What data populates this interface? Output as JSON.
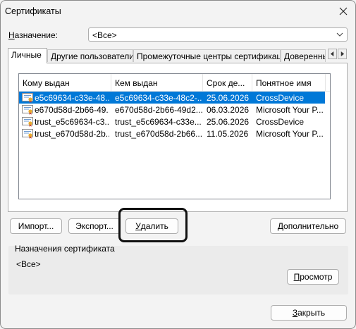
{
  "window": {
    "title": "Сертификаты",
    "close_icon": "close-icon"
  },
  "purpose": {
    "label_pre": "",
    "label_accel": "Н",
    "label_post": "азначение:",
    "value": "<Все>"
  },
  "tabs": [
    {
      "label": "Личные"
    },
    {
      "label": "Другие пользователи"
    },
    {
      "label": "Промежуточные центры сертификации"
    },
    {
      "label": "Доверенные"
    }
  ],
  "list": {
    "columns": [
      "Кому выдан",
      "Кем выдан",
      "Срок де...",
      "Понятное имя"
    ],
    "rows": [
      {
        "issued_to": "e5c69634-c33e-48...",
        "issued_by": "e5c69634-c33e-48c2-...",
        "expires": "25.06.2026",
        "friendly": "CrossDevice",
        "selected": true
      },
      {
        "issued_to": "e670d58d-2b66-49...",
        "issued_by": "e670d58d-2b66-49d2...",
        "expires": "06.03.2026",
        "friendly": "Microsoft Your P...",
        "selected": false
      },
      {
        "issued_to": "trust_e5c69634-c3...",
        "issued_by": "trust_e5c69634-c33e...",
        "expires": "25.06.2026",
        "friendly": "CrossDevice",
        "selected": false
      },
      {
        "issued_to": "trust_e670d58d-2b...",
        "issued_by": "trust_e670d58d-2b66...",
        "expires": "11.05.2026",
        "friendly": "Microsoft Your P...",
        "selected": false
      }
    ]
  },
  "buttons": {
    "import": {
      "pre": "Импорт...",
      "accel": "",
      "post": ""
    },
    "export": {
      "pre": "Экспорт...",
      "accel": "",
      "post": ""
    },
    "delete": {
      "pre": "",
      "accel": "У",
      "post": "далить"
    },
    "advanced": {
      "pre": "",
      "accel": "Д",
      "post": "ополнительно"
    },
    "view": {
      "pre": "",
      "accel": "П",
      "post": "росмотр"
    },
    "close": {
      "pre": "",
      "accel": "З",
      "post": "акрыть"
    }
  },
  "cert_purposes": {
    "title": "Назначения сертификата",
    "value": "<Все>"
  },
  "colors": {
    "selection": "#0078d7",
    "highlight_border": "#111111"
  }
}
